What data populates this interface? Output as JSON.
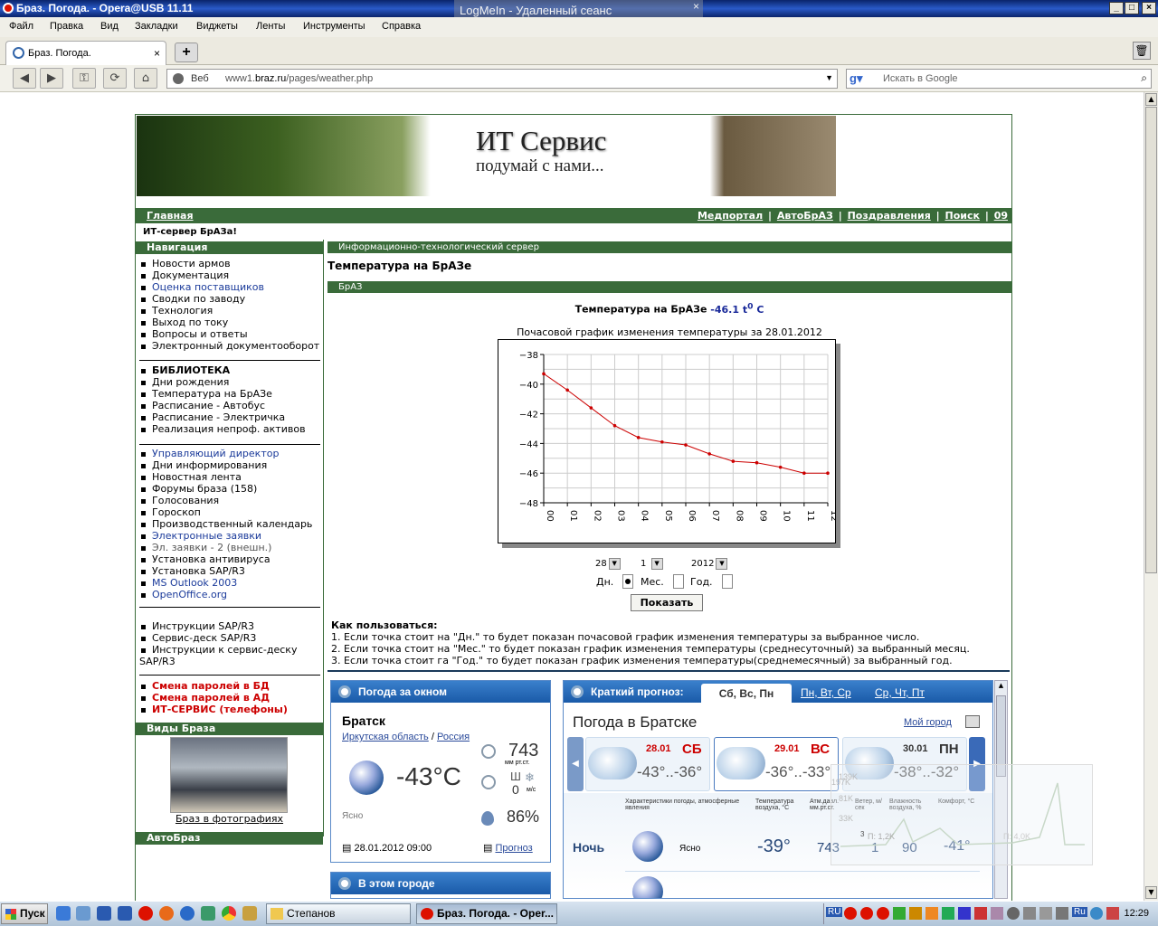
{
  "window": {
    "title": "Браз. Погода. - Opera@USB 11.11"
  },
  "logmein": {
    "label": "LogMeIn - Удаленный сеанс"
  },
  "menu": [
    "Файл",
    "Правка",
    "Вид",
    "Закладки",
    "Виджеты",
    "Ленты",
    "Инструменты",
    "Справка"
  ],
  "tab": {
    "title": "Браз. Погода."
  },
  "address": {
    "scheme_label": "Веб",
    "url_prefix": "www1.",
    "url_domain": "braz.ru",
    "url_path": "/pages/weather.php"
  },
  "search": {
    "placeholder": "Искать в Google"
  },
  "site": {
    "banner_title": "ИТ Сервис",
    "banner_sub": "подумай с нами...",
    "home_link": "Главная",
    "top_links": [
      "Медпортал",
      "АвтоБрАЗ",
      "Поздравления",
      "Поиск",
      "09"
    ],
    "greeting": "ИТ-сервер БрАЗа!",
    "nav_header": "Навигация",
    "nav_group1": [
      {
        "t": "Новости армов",
        "c": ""
      },
      {
        "t": "Документация",
        "c": ""
      },
      {
        "t": "Оценка поставщиков",
        "c": "blue"
      },
      {
        "t": "Сводки по заводу",
        "c": ""
      },
      {
        "t": "Технология",
        "c": ""
      },
      {
        "t": "Выход по току",
        "c": ""
      },
      {
        "t": "Вопросы и ответы",
        "c": ""
      },
      {
        "t": "Электронный документооборот",
        "c": ""
      }
    ],
    "nav_group2": [
      {
        "t": "БИБЛИОТЕКА",
        "c": "bold"
      },
      {
        "t": "Дни рождения",
        "c": ""
      },
      {
        "t": "Температура на БрАЗе",
        "c": ""
      },
      {
        "t": "Расписание - Автобус",
        "c": ""
      },
      {
        "t": "Расписание - Электричка",
        "c": ""
      },
      {
        "t": "Реализация непроф. активов",
        "c": ""
      }
    ],
    "nav_group3": [
      {
        "t": "Управляющий директор",
        "c": "blue"
      },
      {
        "t": "Дни информирования",
        "c": ""
      },
      {
        "t": "Новостная лента",
        "c": ""
      },
      {
        "t": "Форумы браза (158)",
        "c": ""
      },
      {
        "t": "Голосования",
        "c": ""
      },
      {
        "t": "Гороскоп",
        "c": ""
      },
      {
        "t": "Производственный календарь",
        "c": ""
      },
      {
        "t": "Электронные заявки",
        "c": "blue"
      },
      {
        "t": "Эл. заявки - 2 (внешн.)",
        "c": "gray"
      },
      {
        "t": "Установка антивируса",
        "c": ""
      },
      {
        "t": "Установка SAP/R3",
        "c": ""
      },
      {
        "t": "MS Outlook 2003",
        "c": "blue"
      },
      {
        "t": "OpenOffice.org",
        "c": "blue"
      }
    ],
    "nav_group4": [
      {
        "t": "Инструкции SAP/R3",
        "c": ""
      },
      {
        "t": "Сервис-деск SAP/R3",
        "c": ""
      },
      {
        "t": "Инструкции к сервис-деску SAP/R3",
        "c": "wrap"
      }
    ],
    "nav_group5": [
      {
        "t": "Смена паролей в БД",
        "c": "red"
      },
      {
        "t": "Смена паролей в АД",
        "c": "red"
      },
      {
        "t": "ИТ-СЕРВИС (телефоны)",
        "c": "red"
      }
    ],
    "views_header": "Виды Браза",
    "views_caption": "Браз в фотографиях",
    "auto_header": "АвтоБраз",
    "main_header": "Информационно-технологический сервер",
    "page_title": "Температура на БрАЗе",
    "section_header": "БрАЗ",
    "current_label": "Температура на БрАЗе",
    "current_value": "-46.1",
    "current_unit_t": "t",
    "current_unit_sup": "0",
    "current_unit_c": "C",
    "chart_title": "Почасовой график изменения температуры за 28.01.2012",
    "date_day": "28",
    "date_month": "1",
    "date_year": "2012",
    "radio_day": "Дн.",
    "radio_month": "Мес.",
    "radio_year": "Год.",
    "show_button": "Показать",
    "howto_title": "Как пользоваться:",
    "howto_lines": [
      "1. Если точка стоит на \"Дн.\" то будет показан почасовой график изменения температуры за выбранное число.",
      "2. Если точка стоит на \"Мес.\" то будет показан график изменения температуры (среднесуточный) за выбранный месяц.",
      "3. Если точка стоит га \"Год.\" то будет показан график изменения температуры(среднемесячный) за выбранный год."
    ]
  },
  "chart_data": {
    "type": "line",
    "x": [
      "00",
      "01",
      "02",
      "03",
      "04",
      "05",
      "06",
      "07",
      "08",
      "09",
      "10",
      "11",
      "12"
    ],
    "values": [
      -39.3,
      -40.4,
      -41.6,
      -42.8,
      -43.6,
      -43.9,
      -44.1,
      -44.7,
      -45.2,
      -45.3,
      -45.6,
      -46.0,
      -46.0
    ],
    "ylim": [
      -48,
      -38
    ],
    "yticks": [
      -38,
      -40,
      -42,
      -44,
      -46,
      -48
    ],
    "grid": true,
    "color": "#cc0000"
  },
  "weather_now": {
    "header": "Погода за окном",
    "city": "Братск",
    "region": "Иркутская область",
    "country": "Россия",
    "temp": "-43°C",
    "pressure": "743",
    "pressure_unit": "мм рт.ст.",
    "wind_dir": "Ш",
    "wind": "0",
    "wind_unit": "м/с",
    "condition": "Ясно",
    "humidity": "86%",
    "datetime": "28.01.2012 09:00",
    "forecast_link": "Прогноз",
    "next_header": "В этом городе"
  },
  "forecast": {
    "header": "Краткий прогноз:",
    "tab_active": "Сб, Вс, Пн",
    "tab2": "Пн, Вт, Ср",
    "tab3": "Ср, Чт, Пт",
    "title": "Погода в Братске",
    "my_city": "Мой город",
    "days": [
      {
        "date": "28.01",
        "dow": "СБ",
        "temps": "-43°..-36°",
        "dowcolor": "#cc0000"
      },
      {
        "date": "29.01",
        "dow": "ВС",
        "temps": "-36°..-33°",
        "dowcolor": "#cc0000"
      },
      {
        "date": "30.01",
        "dow": "ПН",
        "temps": "-38°..-32°",
        "dowcolor": "#333333"
      }
    ],
    "col_cond": "Характеристики погоды, атмосферные явления",
    "col_temp": "Температура воздуха, °C",
    "col_press": "Атм.давл. мм.рт.ст.",
    "col_wind": "Ветер, м/сек",
    "col_hum": "Влажность воздуха, %",
    "col_comf": "Комфорт, °C",
    "row_label": "Ночь",
    "row_cond": "Ясно",
    "row_temp": "-39°",
    "row_press": "743",
    "row_wind": "1",
    "row_hum": "90",
    "row_comf": "-41°",
    "overlay_labels": [
      "197K",
      "81K",
      "139K",
      "33K"
    ],
    "overlay_bottom": "П: 1,2K",
    "overlay_right": "П: 4,0K",
    "overlay_num": "3"
  },
  "taskbar": {
    "start": "Пуск",
    "tasks": [
      "Степанов",
      "Браз. Погода. - Oper..."
    ],
    "lang1": "RU",
    "lang2": "Ru",
    "clock": "12:29"
  }
}
